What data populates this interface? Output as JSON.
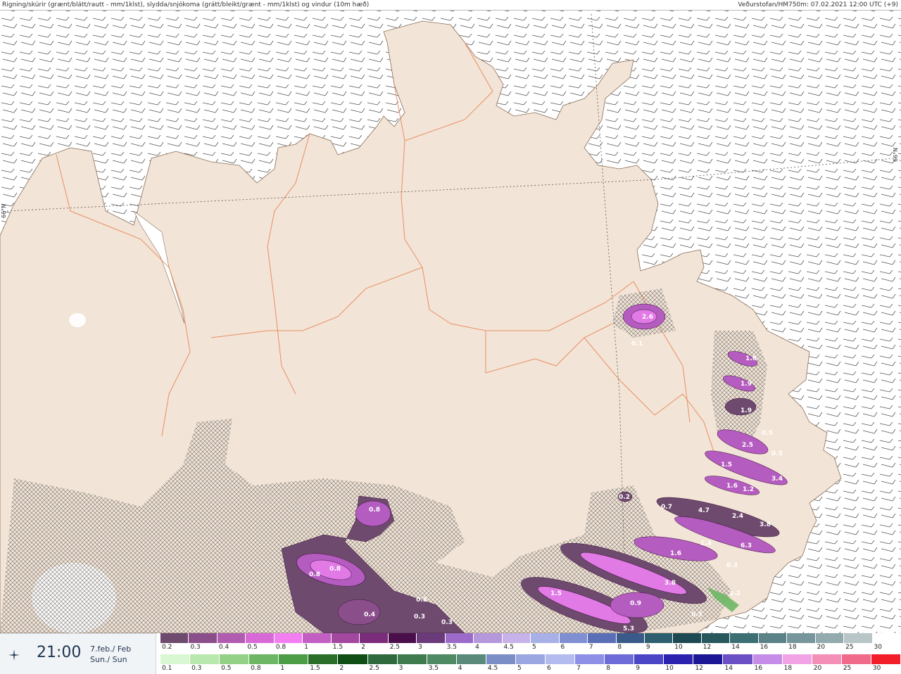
{
  "header": {
    "left_text": "Rigning/skúrir (grænt/blátt/rautt - mm/1klst), slydda/snjókoma (grátt/bleikt/grænt - mm/1klst) og vindur (10m hæð)",
    "right_text": "Veðurstofan/HM750m: 07.02.2021 12:00 UTC (+9)"
  },
  "map": {
    "latitude_label": "66°N",
    "precip_labels": [
      "2.6",
      "0.1",
      "1.6",
      "1.9",
      "1.9",
      "0.5",
      "2.5",
      "0.5",
      "1.5",
      "3.4",
      "1.6",
      "1.2",
      "0.2",
      "0.7",
      "4.7",
      "2.4",
      "3.8",
      "1.4",
      "6.3",
      "1.6",
      "0.3",
      "3.8",
      "2.2",
      "1.5",
      "0.9",
      "0.5",
      "5.3",
      "0.8",
      "0.8",
      "0.8",
      "0.3",
      "0.4",
      "0.3",
      "0.3"
    ]
  },
  "footer": {
    "time": "21:00",
    "date_is": "7.feb./ Feb",
    "day": "Sun./ Sun",
    "snow_scale": {
      "labels": [
        "0.2",
        "0.3",
        "0.4",
        "0.5",
        "0.8",
        "1",
        "1.5",
        "2",
        "2.5",
        "3",
        "3.5",
        "4",
        "4.5",
        "5",
        "6",
        "7",
        "8",
        "9",
        "10",
        "12",
        "14",
        "16",
        "18",
        "20",
        "25",
        "30"
      ],
      "colors": [
        "#6e4a6e",
        "#8a4f8a",
        "#b05cb0",
        "#d86ad8",
        "#f27ef2",
        "#c35fc3",
        "#a3489f",
        "#7b2d7b",
        "#4a0e4a",
        "#6a3a7a",
        "#9c6bc9",
        "#b597dc",
        "#c7b3ea",
        "#a8b0e8",
        "#7f8fd2",
        "#5a6fb5",
        "#3a5a8a",
        "#2e5f6f",
        "#1d4a52",
        "#27585e",
        "#3c6f74",
        "#5a8287",
        "#76969b",
        "#93aaae",
        "#b8c6c8",
        "#ffffff"
      ]
    },
    "rain_scale": {
      "labels": [
        "0.1",
        "0.3",
        "0.5",
        "0.8",
        "1",
        "1.5",
        "2",
        "2.5",
        "3",
        "3.5",
        "4",
        "4.5",
        "5",
        "6",
        "7",
        "8",
        "9",
        "10",
        "12",
        "14",
        "16",
        "18",
        "20",
        "25",
        "30"
      ],
      "colors": [
        "#d9f7d2",
        "#b8e8ad",
        "#93d186",
        "#6db764",
        "#4d9c46",
        "#2a6e2a",
        "#0f4f16",
        "#2e6a3d",
        "#3f7b4e",
        "#4e8a63",
        "#5a8a7a",
        "#7b8fc6",
        "#9aa7e0",
        "#b4bbef",
        "#8e8fe6",
        "#6d6cd9",
        "#4a46c6",
        "#2b23b0",
        "#1c1794",
        "#6b4fc5",
        "#c58ce8",
        "#f2a3e6",
        "#f48fb8",
        "#f06b8a",
        "#f21f2a"
      ]
    }
  }
}
